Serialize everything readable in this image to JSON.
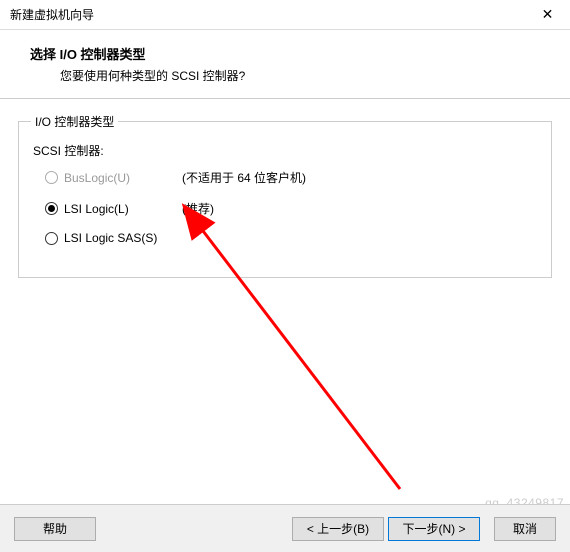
{
  "window": {
    "title": "新建虚拟机向导"
  },
  "header": {
    "title": "选择 I/O 控制器类型",
    "subtitle": "您要使用何种类型的 SCSI 控制器?"
  },
  "group": {
    "legend": "I/O 控制器类型",
    "label": "SCSI 控制器:",
    "options": [
      {
        "label": "BusLogic(U)",
        "note": "(不适用于 64 位客户机)",
        "checked": false,
        "disabled": true
      },
      {
        "label": "LSI Logic(L)",
        "note": "(推荐)",
        "checked": true,
        "disabled": false
      },
      {
        "label": "LSI Logic SAS(S)",
        "note": "",
        "checked": false,
        "disabled": false
      }
    ]
  },
  "buttons": {
    "help": "帮助",
    "back": "< 上一步(B)",
    "next": "下一步(N) >",
    "cancel": "取消"
  },
  "watermark": "qq_43249817"
}
